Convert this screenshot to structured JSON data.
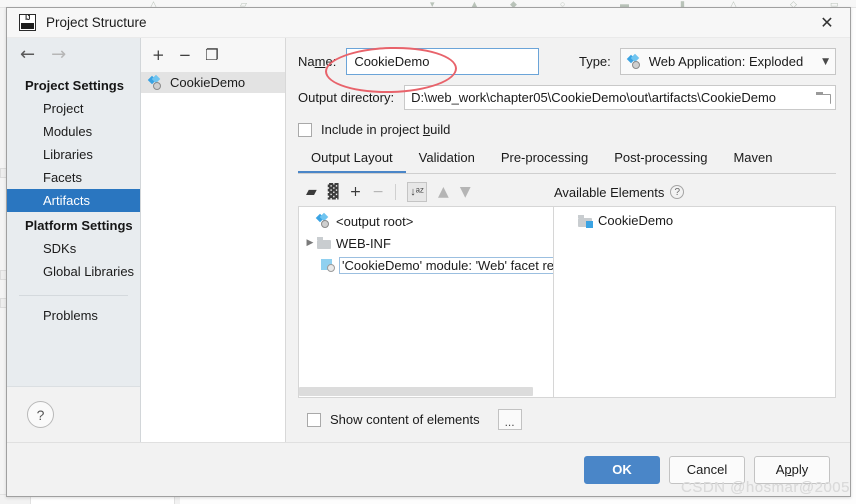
{
  "window": {
    "title": "Project Structure",
    "logo_icon": "intellij-idea-logo",
    "close_icon": "close-icon"
  },
  "sidebar": {
    "back_icon": "arrow-left-icon",
    "forward_icon": "arrow-right-icon",
    "groups": [
      {
        "title": "Project Settings",
        "items": [
          {
            "label": "Project",
            "selected": false
          },
          {
            "label": "Modules",
            "selected": false
          },
          {
            "label": "Libraries",
            "selected": false
          },
          {
            "label": "Facets",
            "selected": false
          },
          {
            "label": "Artifacts",
            "selected": true
          }
        ]
      },
      {
        "title": "Platform Settings",
        "items": [
          {
            "label": "SDKs",
            "selected": false
          },
          {
            "label": "Global Libraries",
            "selected": false
          }
        ]
      }
    ],
    "problems_label": "Problems",
    "help_icon": "help-question-icon",
    "help_label": "?"
  },
  "artifacts_panel": {
    "toolbar": {
      "add_label": "+",
      "remove_label": "−",
      "copy_label": "❐",
      "add_icon": "plus-icon",
      "remove_icon": "minus-icon",
      "copy_icon": "copy-icon"
    },
    "items": [
      {
        "label": "CookieDemo",
        "icon": "artifact-icon",
        "selected": true
      }
    ]
  },
  "form": {
    "name_label": "Name:",
    "name_label_pre": "Na",
    "name_label_accel": "m",
    "name_label_post": "e:",
    "name_value": "CookieDemo",
    "type_label": "Type:",
    "type_value": "Web Application: Exploded",
    "type_icon": "artifact-icon",
    "type_caret_icon": "chevron-down-icon",
    "output_dir_label": "Output directory:",
    "output_dir_value": "D:\\web_work\\chapter05\\CookieDemo\\out\\artifacts\\CookieDemo",
    "browse_icon": "folder-icon",
    "include_in_build_pre": "Include in project ",
    "include_in_build_accel": "b",
    "include_in_build_post": "uild",
    "include_in_build_label": "Include in project build",
    "include_in_build_checked": false
  },
  "tabs": [
    {
      "label": "Output Layout",
      "active": true
    },
    {
      "label": "Validation",
      "active": false
    },
    {
      "label": "Pre-processing",
      "active": false
    },
    {
      "label": "Post-processing",
      "active": false
    },
    {
      "label": "Maven",
      "active": false
    }
  ],
  "layout_toolbar": {
    "add_dir_icon": "add-directory-icon",
    "add_dir_label": "▰",
    "archive_icon": "add-archive-icon",
    "archive_label": "▓",
    "plus_icon": "plus-dropdown-icon",
    "plus_label": "+",
    "minus_icon": "minus-icon",
    "minus_label": "−",
    "sort_icon": "sort-alphabetically-icon",
    "sort_label": "↓ᵃᶻ",
    "up_icon": "move-up-icon",
    "up_label": "▲",
    "down_icon": "move-down-icon",
    "down_label": "▼"
  },
  "output_tree": [
    {
      "label": "<output root>",
      "icon": "artifact-icon",
      "indent": 0,
      "twisty": "",
      "outlined": false
    },
    {
      "label": "WEB-INF",
      "icon": "folder-icon",
      "indent": 0,
      "twisty": "▶",
      "outlined": false
    },
    {
      "label": "'CookieDemo' module: 'Web' facet resources",
      "icon": "facet-resources-icon",
      "indent": 1,
      "twisty": "",
      "outlined": true
    }
  ],
  "available_elements": {
    "title": "Available Elements",
    "help_icon": "help-question-icon",
    "help_label": "?",
    "items": [
      {
        "label": "CookieDemo",
        "icon": "module-folder-icon"
      }
    ]
  },
  "show_content": {
    "label": "Show content of elements",
    "checked": false,
    "more_button_label": "...",
    "more_button_icon": "ellipsis-icon"
  },
  "footer": {
    "ok_label": "OK",
    "cancel_label": "Cancel",
    "apply_label": "Apply",
    "apply_pre": "A",
    "apply_accel": "p",
    "apply_post": "ply"
  },
  "annotations": {
    "highlight_ellipse_color": "#e8636b",
    "highlight_target": "name-input"
  },
  "watermark": {
    "text": "CSDN @hosmar@2005",
    "overlay_text": "CSDN @hosmar@2005"
  },
  "colors": {
    "selection_blue": "#2a76c0",
    "primary_button": "#4a86c8",
    "dialog_bg": "#f2f2f2",
    "sidebar_bg": "#e8ecef",
    "field_focus_border": "#6ba4d8"
  }
}
